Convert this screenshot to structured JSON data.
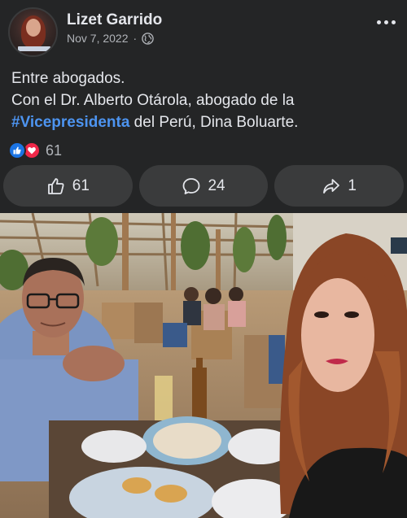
{
  "post": {
    "author": "Lizet Garrido",
    "date": "Nov 7, 2022",
    "separator": "·",
    "text_line1": "Entre abogados.",
    "text_line2": "Con el Dr. Alberto Otárola, abogado de la",
    "hashtag": "#Vicepresidenta",
    "text_line3_rest": " del Perú, Dina Boluarte."
  },
  "reactions": {
    "count": "61",
    "types": [
      "like",
      "love"
    ]
  },
  "actions": {
    "like_count": "61",
    "comment_count": "24",
    "share_count": "1"
  },
  "icons": {
    "privacy": "globe-icon",
    "menu": "more-icon",
    "like": "thumbs-up-icon",
    "comment": "comment-icon",
    "share": "share-arrow-icon"
  },
  "colors": {
    "background": "#242526",
    "button": "#3a3b3c",
    "hashtag": "#4d94f0",
    "like_blue": "#1b74e4",
    "love_red": "#f02849"
  }
}
